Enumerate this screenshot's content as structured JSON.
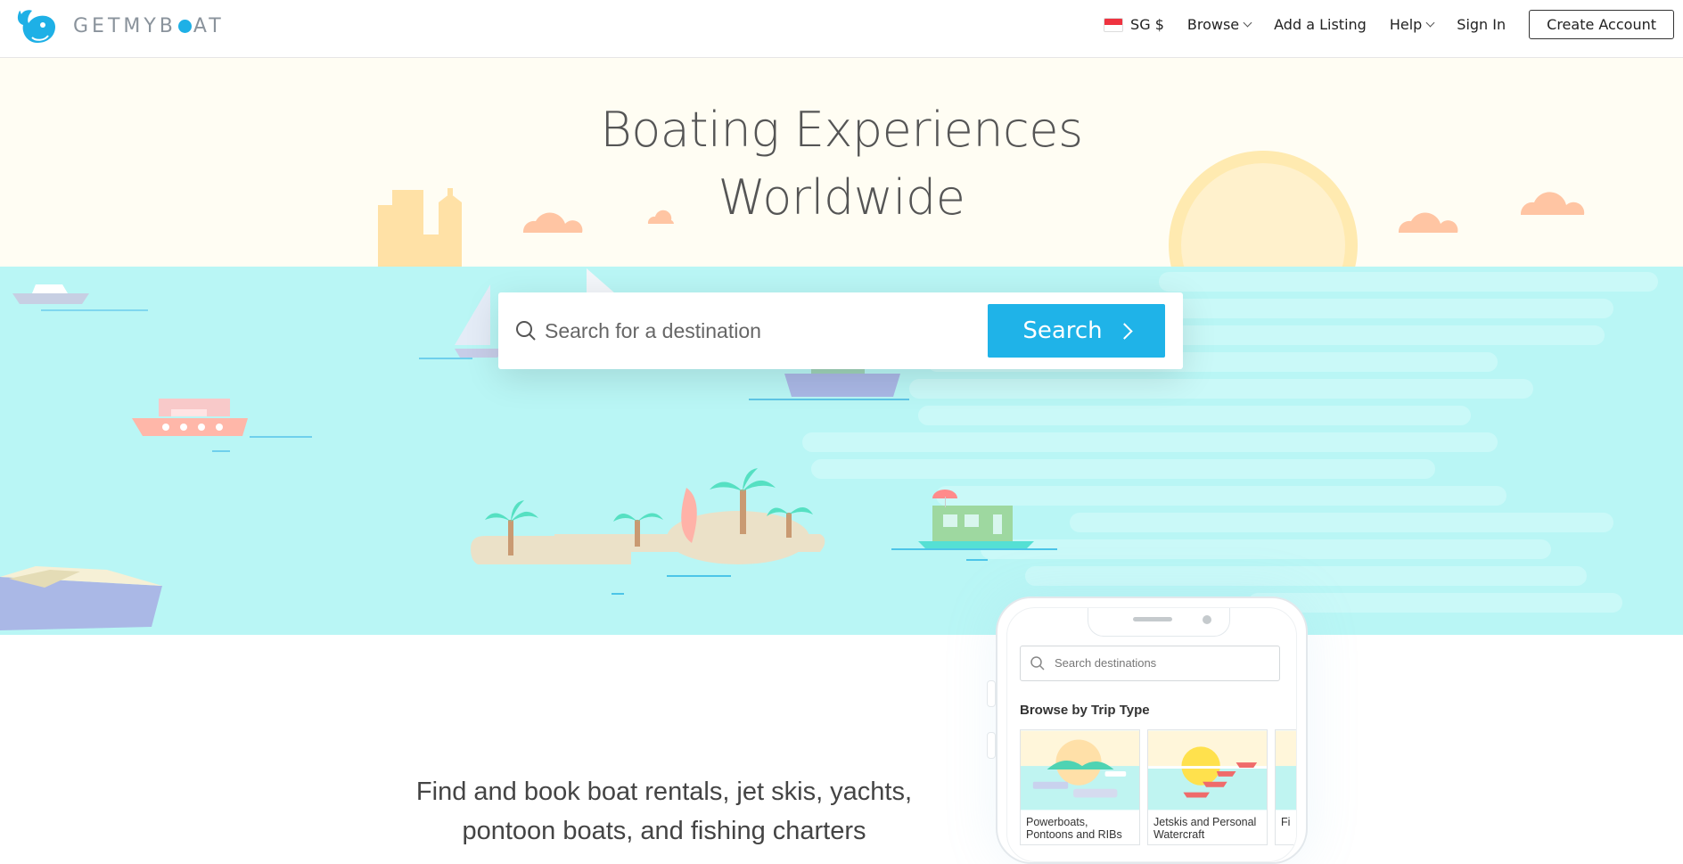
{
  "header": {
    "logo_text_pre": "GETMYB",
    "logo_text_post": "AT",
    "currency": "SG $",
    "nav": {
      "browse": "Browse",
      "add_listing": "Add a Listing",
      "help": "Help",
      "sign_in": "Sign In",
      "create_account": "Create Account"
    }
  },
  "hero": {
    "title_line1": "Boating Experiences",
    "title_line2": "Worldwide",
    "search_placeholder": "Search for a destination",
    "search_button": "Search"
  },
  "lower": {
    "tagline_line1": "Find and book boat rentals, jet skis, yachts,",
    "tagline_line2": "pontoon boats, and fishing charters"
  },
  "phone": {
    "search_placeholder": "Search destinations",
    "heading": "Browse by Trip Type",
    "tiles": [
      {
        "label": "Powerboats, Pontoons and RIBs"
      },
      {
        "label": "Jetskis and Personal Watercraft"
      },
      {
        "label": "Fi"
      }
    ]
  },
  "colors": {
    "brand": "#1eb0e6",
    "sky": "#fffdf3",
    "sea": "#b9f6f5"
  }
}
